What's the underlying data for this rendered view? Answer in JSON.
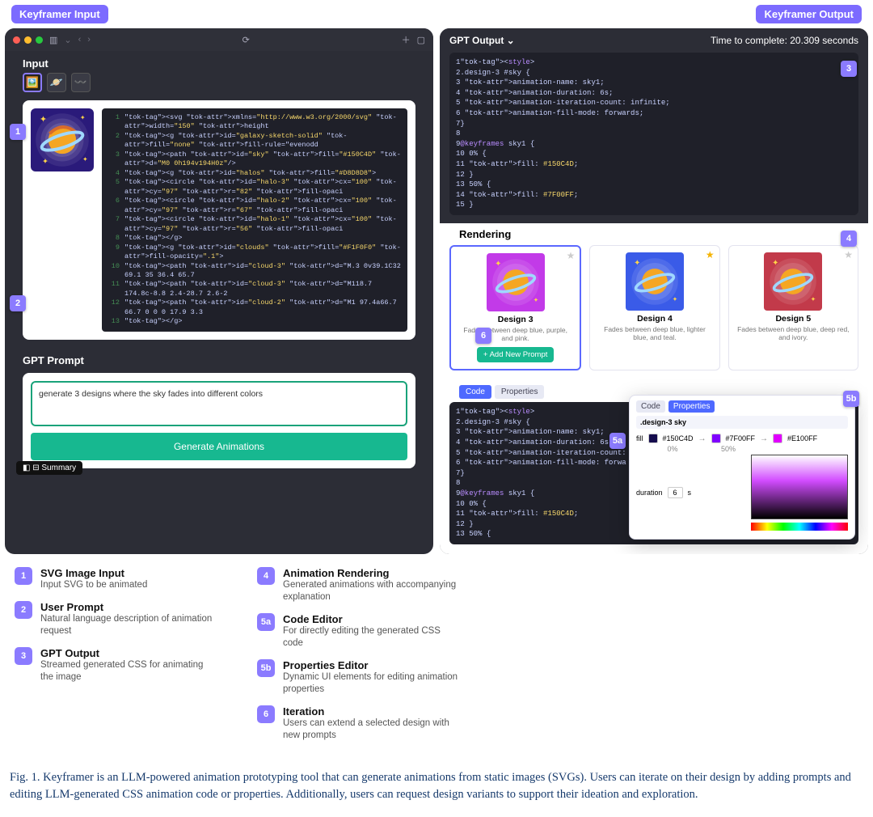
{
  "tags": {
    "left": "Keyframer Input",
    "right": "Keyframer Output"
  },
  "left": {
    "input_label": "Input",
    "svg_code": [
      "<svg xmlns=\"http://www.w3.org/2000/svg\" width=\"150\" height",
      " <g id=\"galaxy-sketch-solid\" fill=\"none\" fill-rule=\"evenodd",
      "  <path id=\"sky\" fill=\"#150C4D\" d=\"M0 0h194v194H0z\"/>",
      "  <g id=\"halos\" fill=\"#D8D8D8\">",
      "   <circle id=\"halo-3\" cx=\"100\" cy=\"97\" r=\"82\" fill-opaci",
      "   <circle id=\"halo-2\" cx=\"100\" cy=\"97\" r=\"67\" fill-opaci",
      "   <circle id=\"halo-1\" cx=\"100\" cy=\"97\" r=\"56\" fill-opaci",
      "  </g>",
      "  <g id=\"clouds\" fill=\"#F1F0F0\" fill-opacity=\".1\">",
      "   <path id=\"cloud-3\" d=\"M.3 0v39.1C32 69.1 35 36.4 65.7",
      "   <path id=\"cloud-3\" d=\"M118.7 174.8c-8.8 2.4-28.7 2.6-2",
      "   <path id=\"cloud-2\" d=\"M1 97.4a66.7 66.7 0 0 0 17.9 3.3",
      "  </g>"
    ],
    "prompt_label": "GPT Prompt",
    "prompt_value": "generate 3 designs where the sky fades into different colors",
    "generate_btn": "Generate Animations",
    "summary_chip": "Summary"
  },
  "right": {
    "header_left": "GPT Output",
    "header_right": "Time to complete: 20.309 seconds",
    "css_code": [
      "<style>",
      ".design-3 #sky {",
      "  animation-name: sky1;",
      "  animation-duration: 6s;",
      "  animation-iteration-count: infinite;",
      "  animation-fill-mode: forwards;",
      "}",
      "",
      "@keyframes sky1 {",
      "  0% {",
      "    fill: #150C4D;",
      "  }",
      "  50% {",
      "    fill: #7F00FF;",
      "  }"
    ],
    "rendering_label": "Rendering",
    "designs": [
      {
        "title": "Design 3",
        "sub": "Fades between deep blue, purple, and pink.",
        "bg": "#c23ae8",
        "selected": true,
        "star": false
      },
      {
        "title": "Design 4",
        "sub": "Fades between deep blue, lighter blue, and teal.",
        "bg": "#3a5be8",
        "selected": false,
        "star": true
      },
      {
        "title": "Design 5",
        "sub": "Fades between deep blue, deep red, and ivory.",
        "bg": "#c23a4a",
        "selected": false,
        "star": false
      }
    ],
    "add_prompt_btn": "+ Add New Prompt",
    "tabs": {
      "code": "Code",
      "properties": "Properties"
    },
    "code2": [
      "<style>",
      ".design-3 #sky {",
      "  animation-name: sky1;",
      "  animation-duration: 6s;",
      "  animation-iteration-count:",
      "  animation-fill-mode: forwa",
      "}",
      "",
      "@keyframes sky1 {",
      "  0% {",
      "    fill: #150C4D;",
      "  }",
      "  50% {"
    ],
    "props": {
      "selector": ".design-3 sky",
      "fill_label": "fill",
      "colors": [
        {
          "hex": "#150C4D",
          "pct": "0%"
        },
        {
          "hex": "#7F00FF",
          "pct": "50%"
        },
        {
          "hex": "#E100FF",
          "pct": ""
        }
      ],
      "duration_label": "duration",
      "duration_value": "6",
      "duration_unit": "s"
    }
  },
  "legend": [
    {
      "n": "1",
      "title": "SVG Image Input",
      "desc": "Input SVG to be animated"
    },
    {
      "n": "2",
      "title": "User Prompt",
      "desc": "Natural language description of animation request"
    },
    {
      "n": "3",
      "title": "GPT Output",
      "desc": "Streamed generated CSS for animating the image"
    },
    {
      "n": "4",
      "title": "Animation Rendering",
      "desc": "Generated animations with accompanying explanation"
    },
    {
      "n": "5a",
      "title": "Code Editor",
      "desc": "For directly editing the generated CSS code"
    },
    {
      "n": "5b",
      "title": "Properties Editor",
      "desc": "Dynamic UI elements for editing animation properties"
    },
    {
      "n": "6",
      "title": "Iteration",
      "desc": "Users can extend a selected design with new prompts"
    }
  ],
  "caption": "Fig. 1.  Keyframer is an LLM-powered animation prototyping tool that can generate animations from static images (SVGs). Users can iterate on their design by adding prompts and editing LLM-generated CSS animation code or properties. Additionally, users can request design variants to support their ideation and exploration."
}
